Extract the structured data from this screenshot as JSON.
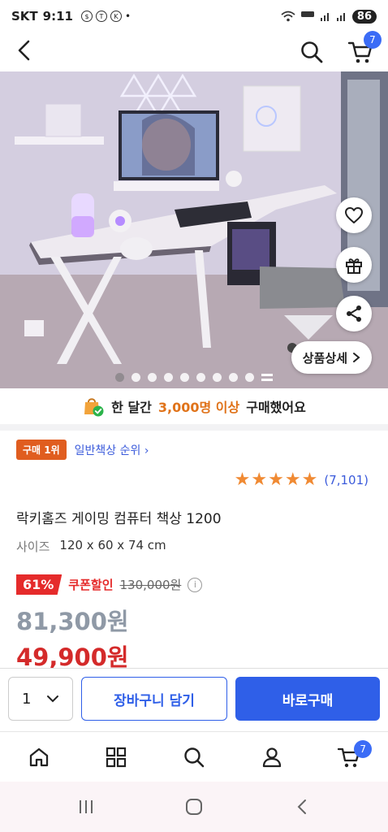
{
  "status_bar": {
    "carrier": "SKT",
    "time": "9:11",
    "battery": "86"
  },
  "header": {
    "cart_count": "7"
  },
  "gallery": {
    "detail_button_label": "상품상세"
  },
  "social_proof": {
    "prefix": "한 달간",
    "highlight": "3,000명 이상",
    "suffix": "구매했어요"
  },
  "rank": {
    "badge": "구매 1위",
    "category_link": "일반책상 순위"
  },
  "rating": {
    "stars": 5,
    "review_count": "(7,101)"
  },
  "product": {
    "title": "락키홈즈 게이밍 컴퓨터 책상 1200",
    "spec_label": "사이즈",
    "spec_value": "120 x 60 x 74 cm"
  },
  "pricing": {
    "discount_rate": "61%",
    "coupon_label": "쿠폰할인",
    "original_price": "130,000원",
    "regular_price": "81,300원",
    "sale_price": "49,900원"
  },
  "purchase_bar": {
    "quantity": "1",
    "add_to_cart": "장바구니 담기",
    "buy_now": "바로구매"
  },
  "tab_bar": {
    "cart_count": "7"
  },
  "colors": {
    "accent_blue": "#2f5fe8",
    "sale_red": "#d42a2a",
    "star_orange": "#f08a33"
  }
}
